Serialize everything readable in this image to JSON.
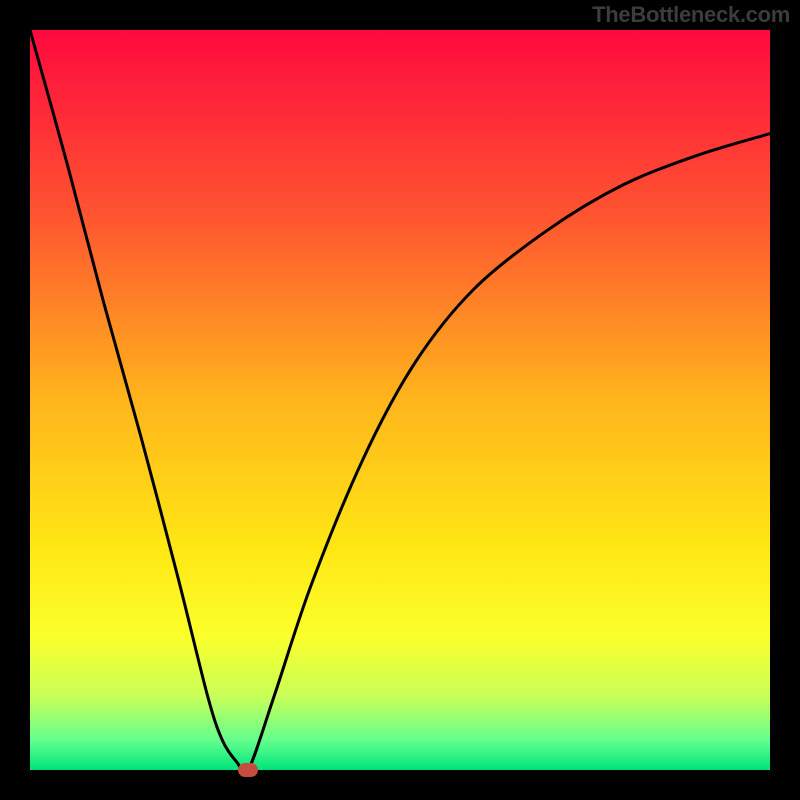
{
  "watermark": "TheBottleneck.com",
  "chart_data": {
    "type": "line",
    "title": "",
    "xlabel": "",
    "ylabel": "",
    "xlim": [
      0,
      100
    ],
    "ylim": [
      0,
      100
    ],
    "series": [
      {
        "name": "bottleneck-curve",
        "x": [
          0,
          5,
          10,
          15,
          20,
          24,
          26,
          28,
          29.5,
          33,
          38,
          45,
          52,
          60,
          70,
          80,
          90,
          100
        ],
        "y": [
          100,
          82,
          63,
          45,
          26,
          10,
          4,
          1,
          0,
          10,
          25,
          42,
          55,
          65,
          73,
          79,
          83,
          86
        ]
      }
    ],
    "minimum_marker": {
      "x": 29.5,
      "y": 0,
      "color": "#c54d3f"
    },
    "background_gradient": {
      "stops": [
        {
          "offset": 0,
          "color": "#ff093f"
        },
        {
          "offset": 25,
          "color": "#ff5430"
        },
        {
          "offset": 50,
          "color": "#ffb51c"
        },
        {
          "offset": 70,
          "color": "#ffe714"
        },
        {
          "offset": 82,
          "color": "#fbff2b"
        },
        {
          "offset": 90,
          "color": "#c9ff58"
        },
        {
          "offset": 96,
          "color": "#63ff8d"
        },
        {
          "offset": 100,
          "color": "#00e47a"
        }
      ]
    }
  }
}
